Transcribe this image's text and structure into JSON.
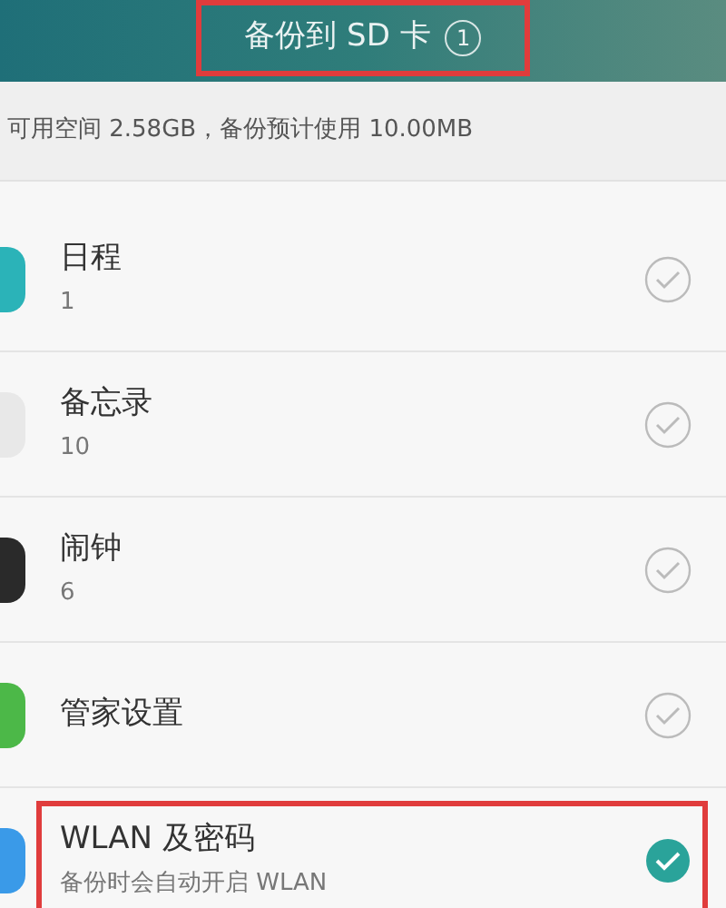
{
  "header": {
    "title": "备份到 SD 卡",
    "badge": "1",
    "highlighted": true
  },
  "storage_info": "可用空间 2.58GB，备份预计使用 10.00MB",
  "items": [
    {
      "title": "日程",
      "subtitle": "1",
      "checked": false,
      "highlighted": false,
      "color": "#2bb3b8"
    },
    {
      "title": "备忘录",
      "subtitle": "10",
      "checked": false,
      "highlighted": false,
      "color": "#e8e8e8"
    },
    {
      "title": "闹钟",
      "subtitle": "6",
      "checked": false,
      "highlighted": false,
      "color": "#2a2a2a"
    },
    {
      "title": "管家设置",
      "checked": false,
      "highlighted": false,
      "color": "#4cb848"
    },
    {
      "title": "WLAN 及密码",
      "subtitle": "备份时会自动开启 WLAN",
      "checked": true,
      "highlighted": true,
      "color": "#3a9ae8"
    }
  ]
}
